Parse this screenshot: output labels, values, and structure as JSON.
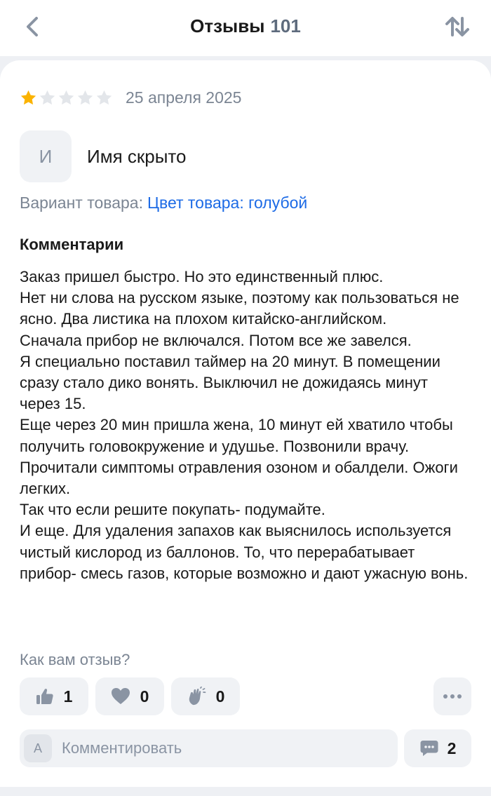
{
  "header": {
    "title": "Отзывы",
    "count": "101"
  },
  "review": {
    "rating": 1,
    "max_rating": 5,
    "date": "25 апреля 2025",
    "author": {
      "initial": "И",
      "name": "Имя скрыто"
    },
    "variant": {
      "label": "Вариант товара:",
      "value": "Цвет товара: голубой"
    },
    "comments_heading": "Комментарии",
    "text": "Заказ пришел быстро. Но это единственный плюс.\nНет ни слова на русском языке, поэтому как пользоваться не ясно. Два листика на плохом китайско-английском.\nСначала прибор не включался. Потом все же завелся.\nЯ специально поставил таймер на 20 минут. В помещении сразу стало дико вонять. Выключил не дожидаясь минут через 15.\nЕще через 20 мин пришла жена, 10 минут ей хватило чтобы получить головокружение и удушье. Позвонили врачу. Прочитали симптомы отравления озоном и обалдели. Ожоги легких.\nТак что если решите покупать- подумайте.\nИ еще. Для удаления запахов как выяснилось используется чистый кислород из баллонов. То, что перерабатывает прибор- смесь газов, которые возможно и дают ужасную вонь."
  },
  "feedback": {
    "question": "Как вам отзыв?",
    "reactions": [
      {
        "icon": "thumbs-up-icon",
        "count": "1"
      },
      {
        "icon": "heart-icon",
        "count": "0"
      },
      {
        "icon": "clapping-hands-icon",
        "count": "0"
      }
    ]
  },
  "comment_box": {
    "avatar_initial": "А",
    "placeholder": "Комментировать",
    "comments_count": "2"
  },
  "colors": {
    "star_filled": "#fbb300",
    "star_empty": "#e3e6ea",
    "link": "#1d6be6",
    "muted": "#7b8593",
    "icon": "#8a94a3"
  }
}
